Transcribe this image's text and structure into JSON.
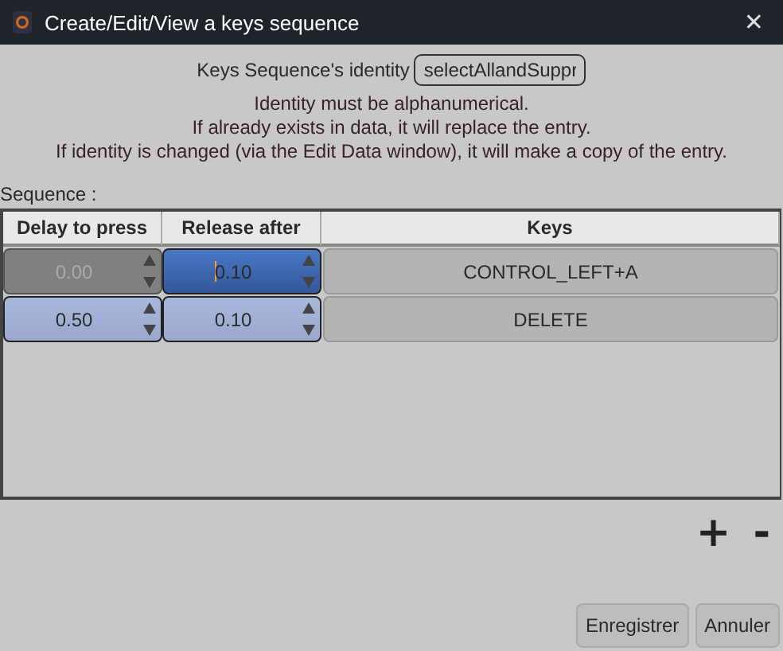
{
  "window": {
    "title": "Create/Edit/View a keys sequence",
    "close": "✕"
  },
  "identity": {
    "label": "Keys Sequence's identity",
    "value": "selectAllandSuppr"
  },
  "notes": [
    "Identity must be alphanumerical.",
    "If already exists in data, it will replace the entry.",
    "If identity is changed (via the Edit Data window), it will make a copy of the entry."
  ],
  "sequence_label": "Sequence :",
  "table": {
    "columns": [
      "Delay to press",
      "Release after",
      "Keys"
    ],
    "rows": [
      {
        "delay": {
          "value": "0.00",
          "disabled": true,
          "focused": false
        },
        "release": {
          "value": "0.10",
          "disabled": false,
          "focused": true
        },
        "keys": "CONTROL_LEFT+A"
      },
      {
        "delay": {
          "value": "0.50",
          "disabled": false,
          "focused": false
        },
        "release": {
          "value": "0.10",
          "disabled": false,
          "focused": false
        },
        "keys": "DELETE"
      }
    ]
  },
  "row_buttons": [
    "+",
    "-"
  ],
  "buttons": [
    "Enregistrer",
    "Annuler"
  ]
}
